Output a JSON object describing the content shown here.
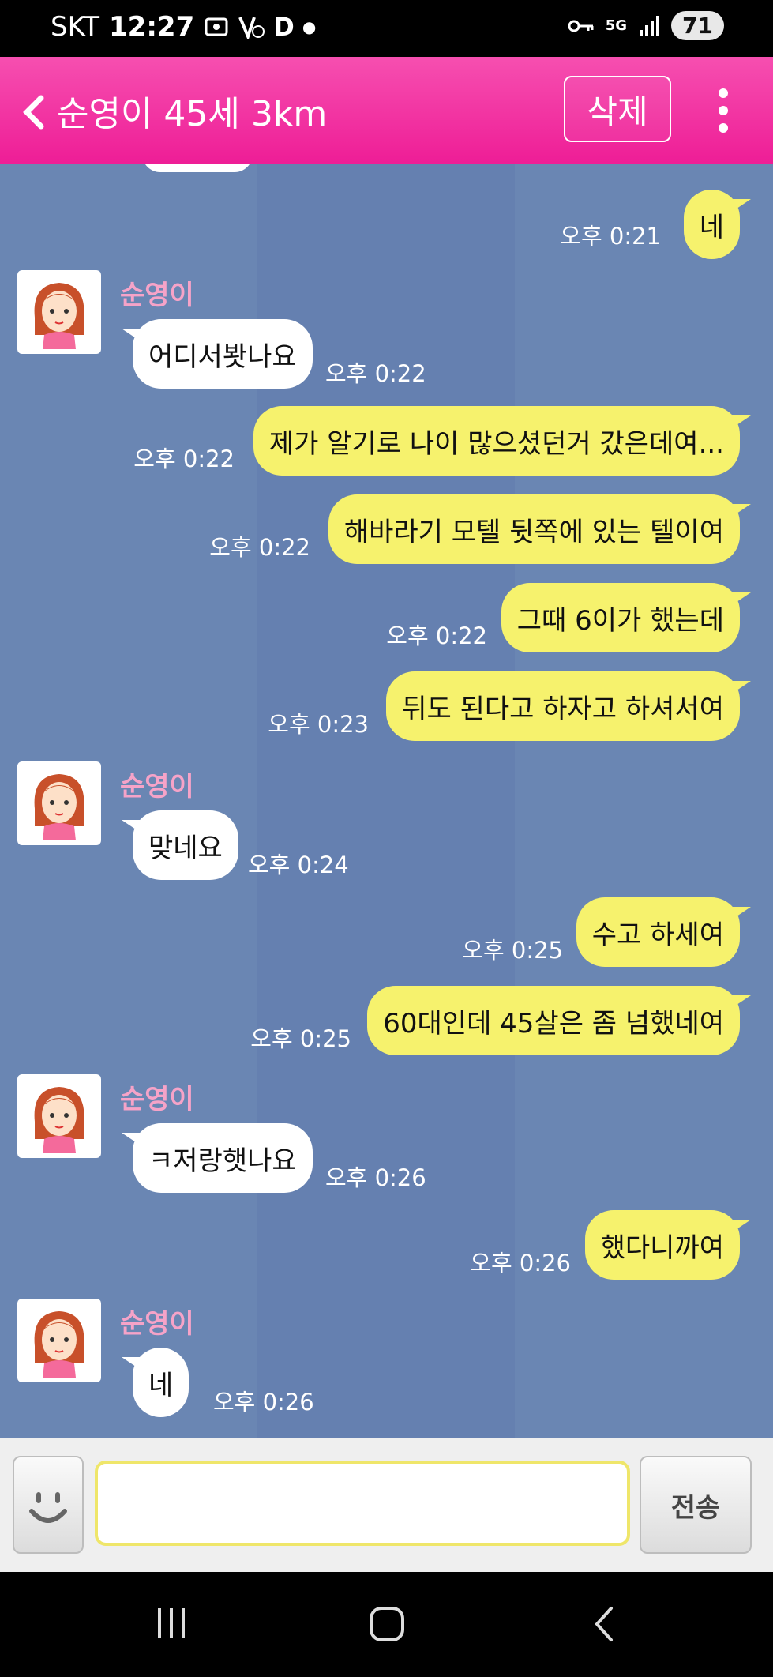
{
  "status_bar": {
    "carrier": "SKT",
    "time": "12:27",
    "network": "5G",
    "battery": "71"
  },
  "header": {
    "title": "순영이 45세 3km",
    "delete_label": "삭제"
  },
  "contact": {
    "name": "순영이"
  },
  "messages": [
    {
      "from": "me",
      "text": "네",
      "time": "오후 0:21"
    },
    {
      "from": "them",
      "text": "어디서봣나요",
      "time": "오후 0:22"
    },
    {
      "from": "me",
      "text": "제가 알기로 나이 많으셨던거 갔은데여...",
      "time": "오후 0:22"
    },
    {
      "from": "me",
      "text": "해바라기 모텔 뒷쪽에 있는 텔이여",
      "time": "오후 0:22"
    },
    {
      "from": "me",
      "text": "그때 6이가 했는데",
      "time": "오후 0:22"
    },
    {
      "from": "me",
      "text": "뒤도 된다고 하자고 하셔서여",
      "time": "오후 0:23"
    },
    {
      "from": "them",
      "text": "맞네요",
      "time": "오후 0:24"
    },
    {
      "from": "me",
      "text": "수고 하세여",
      "time": "오후 0:25"
    },
    {
      "from": "me",
      "text": "60대인데 45살은 좀 넘했네여",
      "time": "오후 0:25"
    },
    {
      "from": "them",
      "text": "ㅋ저랑햇나요",
      "time": "오후 0:26"
    },
    {
      "from": "me",
      "text": "했다니까여",
      "time": "오후 0:26"
    },
    {
      "from": "them",
      "text": "네",
      "time": "오후 0:26"
    }
  ],
  "input": {
    "value": "",
    "send_label": "전송"
  },
  "colors": {
    "header": "#ee1d96",
    "chat_background": "#6a86b3",
    "my_bubble": "#f6f26d",
    "their_bubble": "#ffffff",
    "sender_name": "#f6a3c8"
  }
}
